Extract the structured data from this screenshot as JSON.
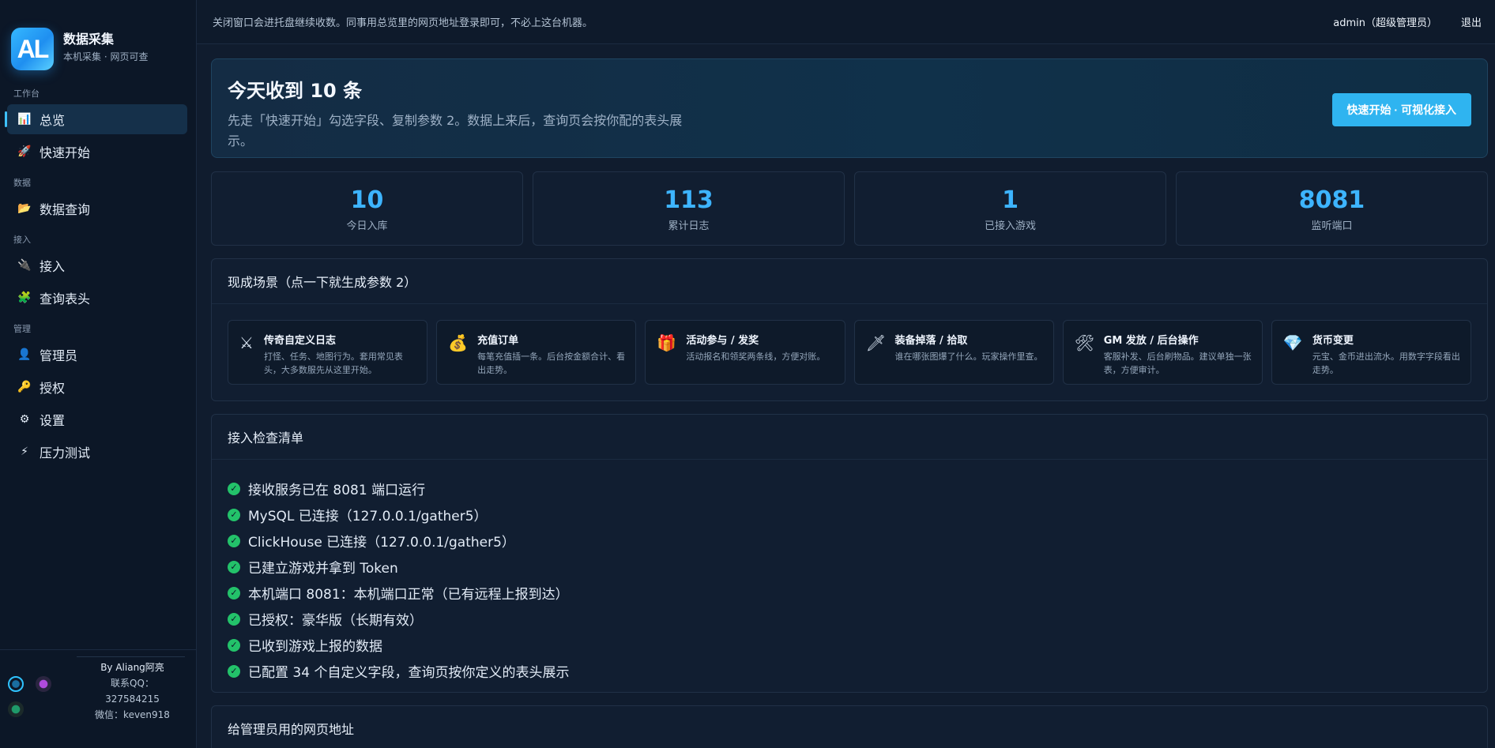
{
  "brand": {
    "logo_text": "AL",
    "title": "数据采集",
    "subtitle": "本机采集 · 网页可查"
  },
  "sidebar": {
    "groups": [
      {
        "title": "工作台",
        "items": [
          {
            "label": "总览",
            "icon": "chart-icon",
            "glyph": "📊",
            "active": true
          },
          {
            "label": "快速开始",
            "icon": "rocket-icon",
            "glyph": "🚀"
          }
        ]
      },
      {
        "title": "数据",
        "items": [
          {
            "label": "数据查询",
            "icon": "folder-icon",
            "glyph": "📂"
          }
        ]
      },
      {
        "title": "接入",
        "items": [
          {
            "label": "接入",
            "icon": "plug-icon",
            "glyph": "🔌"
          },
          {
            "label": "查询表头",
            "icon": "puzzle-icon",
            "glyph": "🧩"
          }
        ]
      },
      {
        "title": "管理",
        "items": [
          {
            "label": "管理员",
            "icon": "user-icon",
            "glyph": "👤"
          },
          {
            "label": "授权",
            "icon": "key-icon",
            "glyph": "🔑"
          },
          {
            "label": "设置",
            "icon": "gear-icon",
            "glyph": "⚙"
          },
          {
            "label": "压力测试",
            "icon": "lightning-icon",
            "glyph": "⚡"
          }
        ]
      }
    ],
    "footer": {
      "by": "By Aliang阿亮",
      "qq_label": "联系QQ：",
      "qq": "327584215",
      "wechat": "微信：keven918"
    }
  },
  "topbar": {
    "note": "关闭窗口会进托盘继续收数。同事用总览里的网页地址登录即可，不必上这台机器。",
    "user": "admin（超级管理员）",
    "logout": "退出"
  },
  "hero": {
    "title": "今天收到 10 条",
    "description": "先走「快速开始」勾选字段、复制参数 2。数据上来后，查询页会按你配的表头展示。",
    "button": "快速开始 · 可视化接入"
  },
  "stats": [
    {
      "value": "10",
      "label": "今日入库"
    },
    {
      "value": "113",
      "label": "累计日志"
    },
    {
      "value": "1",
      "label": "已接入游戏"
    },
    {
      "value": "8081",
      "label": "监听端口"
    }
  ],
  "scenes": {
    "title": "现成场景（点一下就生成参数 2）",
    "items": [
      {
        "icon": "crossed-swords-icon",
        "glyph": "⚔",
        "title": "传奇自定义日志",
        "desc": "打怪、任务、地图行为。套用常见表头，大多数服先从这里开始。"
      },
      {
        "icon": "money-bag-icon",
        "glyph": "💰",
        "title": "充值订单",
        "desc": "每笔充值插一条。后台按金额合计、看出走势。"
      },
      {
        "icon": "gift-icon",
        "glyph": "🎁",
        "title": "活动参与 / 发奖",
        "desc": "活动报名和领奖两条线，方便对账。"
      },
      {
        "icon": "sword-icon",
        "glyph": "🗡",
        "title": "装备掉落 / 拾取",
        "desc": "谁在哪张图爆了什么。玩家操作里查。"
      },
      {
        "icon": "tools-icon",
        "glyph": "🛠",
        "title": "GM 发放 / 后台操作",
        "desc": "客服补发、后台刷物品。建议单独一张表，方便审计。"
      },
      {
        "icon": "gem-icon",
        "glyph": "💎",
        "title": "货币变更",
        "desc": "元宝、金币进出流水。用数字字段看出走势。"
      }
    ]
  },
  "checklist": {
    "title": "接入检查清单",
    "items": [
      "接收服务已在 8081 端口运行",
      "MySQL 已连接（127.0.0.1/gather5）",
      "ClickHouse 已连接（127.0.0.1/gather5）",
      "已建立游戏并拿到 Token",
      "本机端口 8081：本机端口正常（已有远程上报到达）",
      "已授权：豪华版（长期有效）",
      "已收到游戏上报的数据",
      "已配置 34 个自定义字段，查询页按你定义的表头展示"
    ]
  },
  "admin_url_panel": {
    "title": "给管理员用的网页地址"
  },
  "colors": {
    "accent": "#2fb4f0",
    "stat_value": "#3db4ff",
    "check": "#23c26a",
    "background": "#101c2e"
  }
}
